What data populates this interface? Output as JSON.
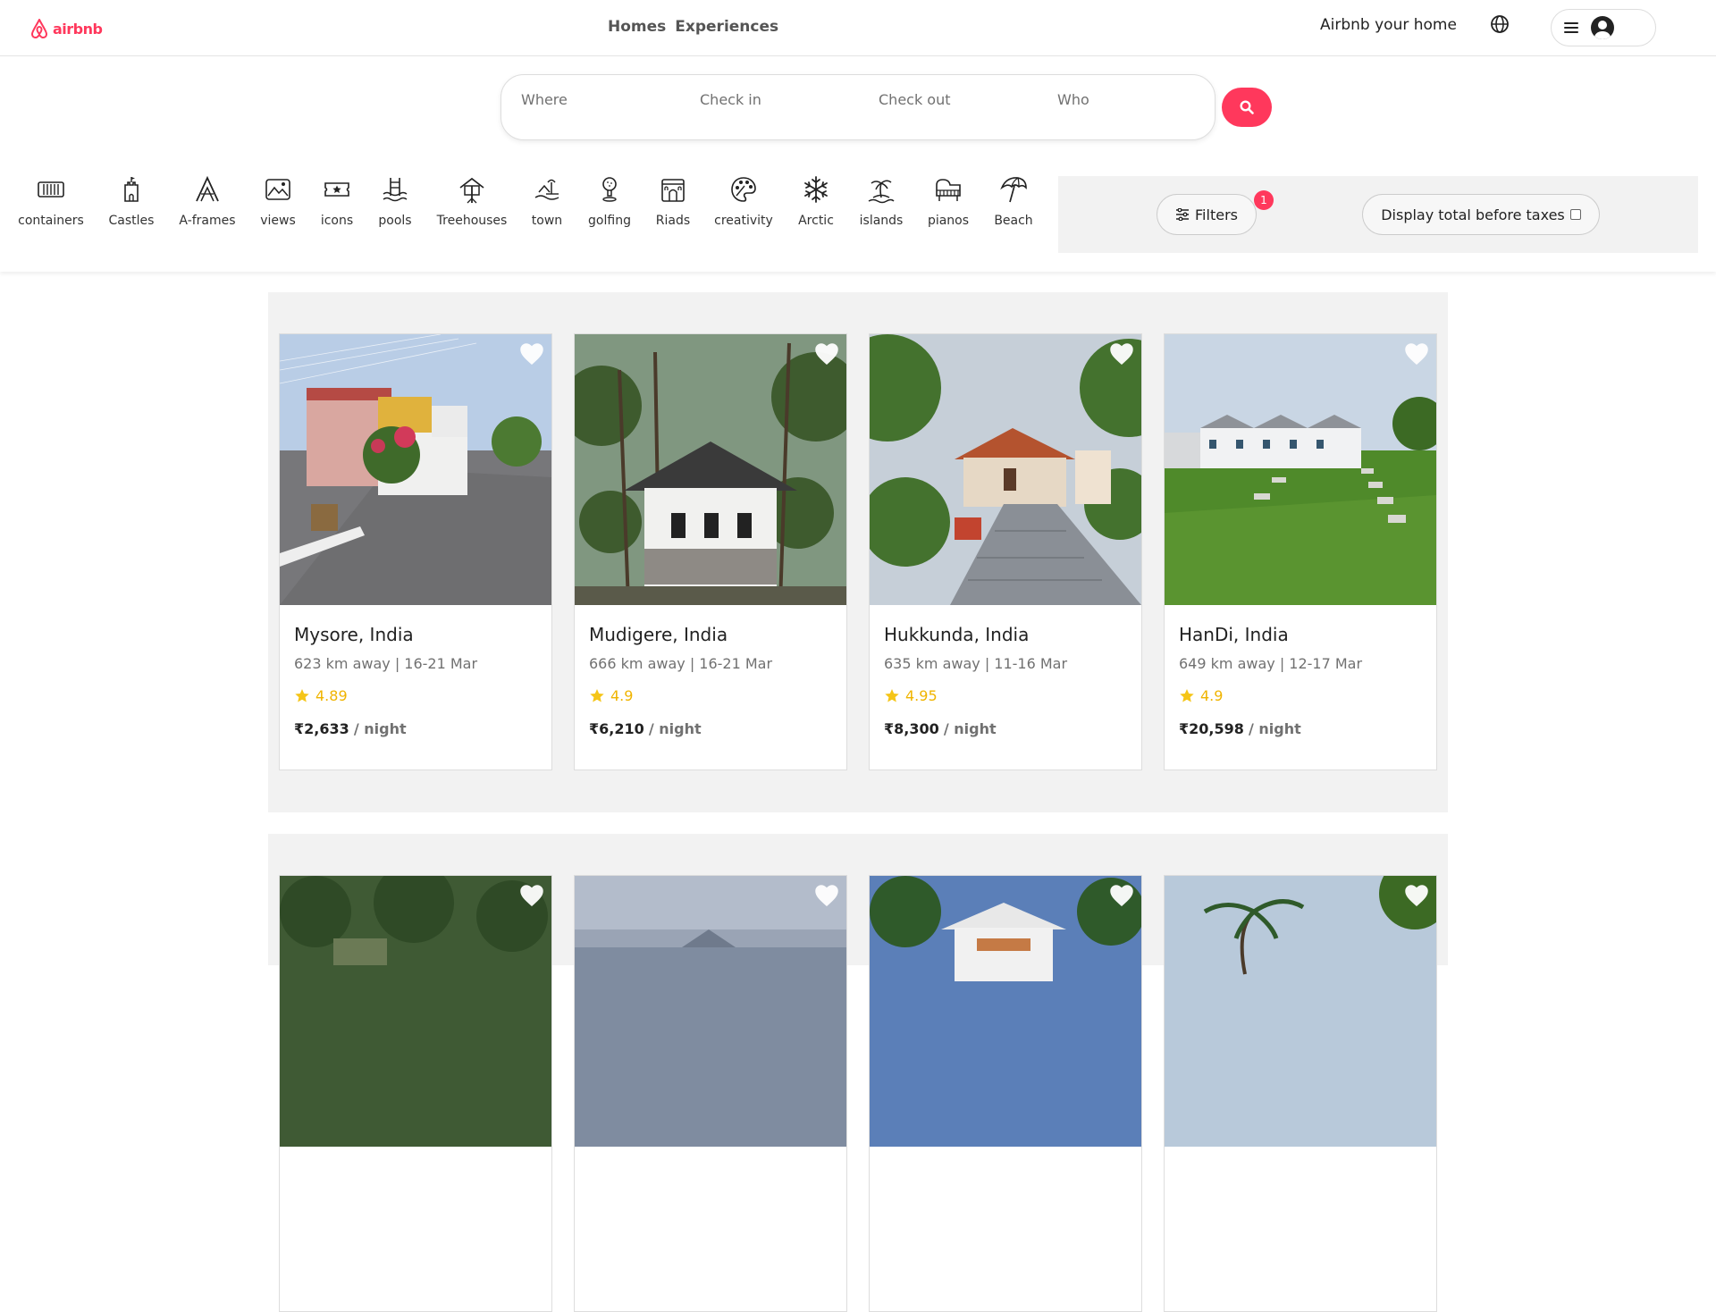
{
  "header": {
    "logo_text": "airbnb",
    "nav": [
      {
        "label": "Homes"
      },
      {
        "label": "Experiences"
      }
    ],
    "host_link": "Airbnb your home",
    "brand_color": "#ff385c"
  },
  "search": {
    "where": "Where",
    "check_in": "Check in",
    "check_out": "Check out",
    "who": "Who"
  },
  "categories": [
    {
      "label": "containers",
      "icon": "container-icon"
    },
    {
      "label": "Castles",
      "icon": "castle-icon"
    },
    {
      "label": "A-frames",
      "icon": "a-frame-icon"
    },
    {
      "label": "views",
      "icon": "views-icon"
    },
    {
      "label": "icons",
      "icon": "icons-icon"
    },
    {
      "label": "pools",
      "icon": "pool-icon"
    },
    {
      "label": "Treehouses",
      "icon": "treehouse-icon"
    },
    {
      "label": "town",
      "icon": "town-icon"
    },
    {
      "label": "golfing",
      "icon": "golf-icon"
    },
    {
      "label": "Riads",
      "icon": "riad-icon"
    },
    {
      "label": "creativity",
      "icon": "palette-icon"
    },
    {
      "label": "Arctic",
      "icon": "snowflake-icon"
    },
    {
      "label": "islands",
      "icon": "island-icon"
    },
    {
      "label": "pianos",
      "icon": "piano-icon"
    },
    {
      "label": "Beach",
      "icon": "umbrella-icon"
    }
  ],
  "filters": {
    "label": "Filters",
    "badge": "1",
    "taxes_label": "Display total before taxes"
  },
  "listings": [
    {
      "title": "Mysore, India",
      "sub": "623 km away | 16-21 Mar",
      "rating": "4.89",
      "price": "₹2,633",
      "per": "/ night"
    },
    {
      "title": "Mudigere, India",
      "sub": "666 km away | 16-21 Mar",
      "rating": "4.9",
      "price": "₹6,210",
      "per": "/ night"
    },
    {
      "title": "Hukkunda, India",
      "sub": "635 km away | 11-16 Mar",
      "rating": "4.95",
      "price": "₹8,300",
      "per": "/ night"
    },
    {
      "title": "HanDi, India",
      "sub": "649 km away | 12-17 Mar",
      "rating": "4.9",
      "price": "₹20,598",
      "per": "/ night"
    }
  ]
}
